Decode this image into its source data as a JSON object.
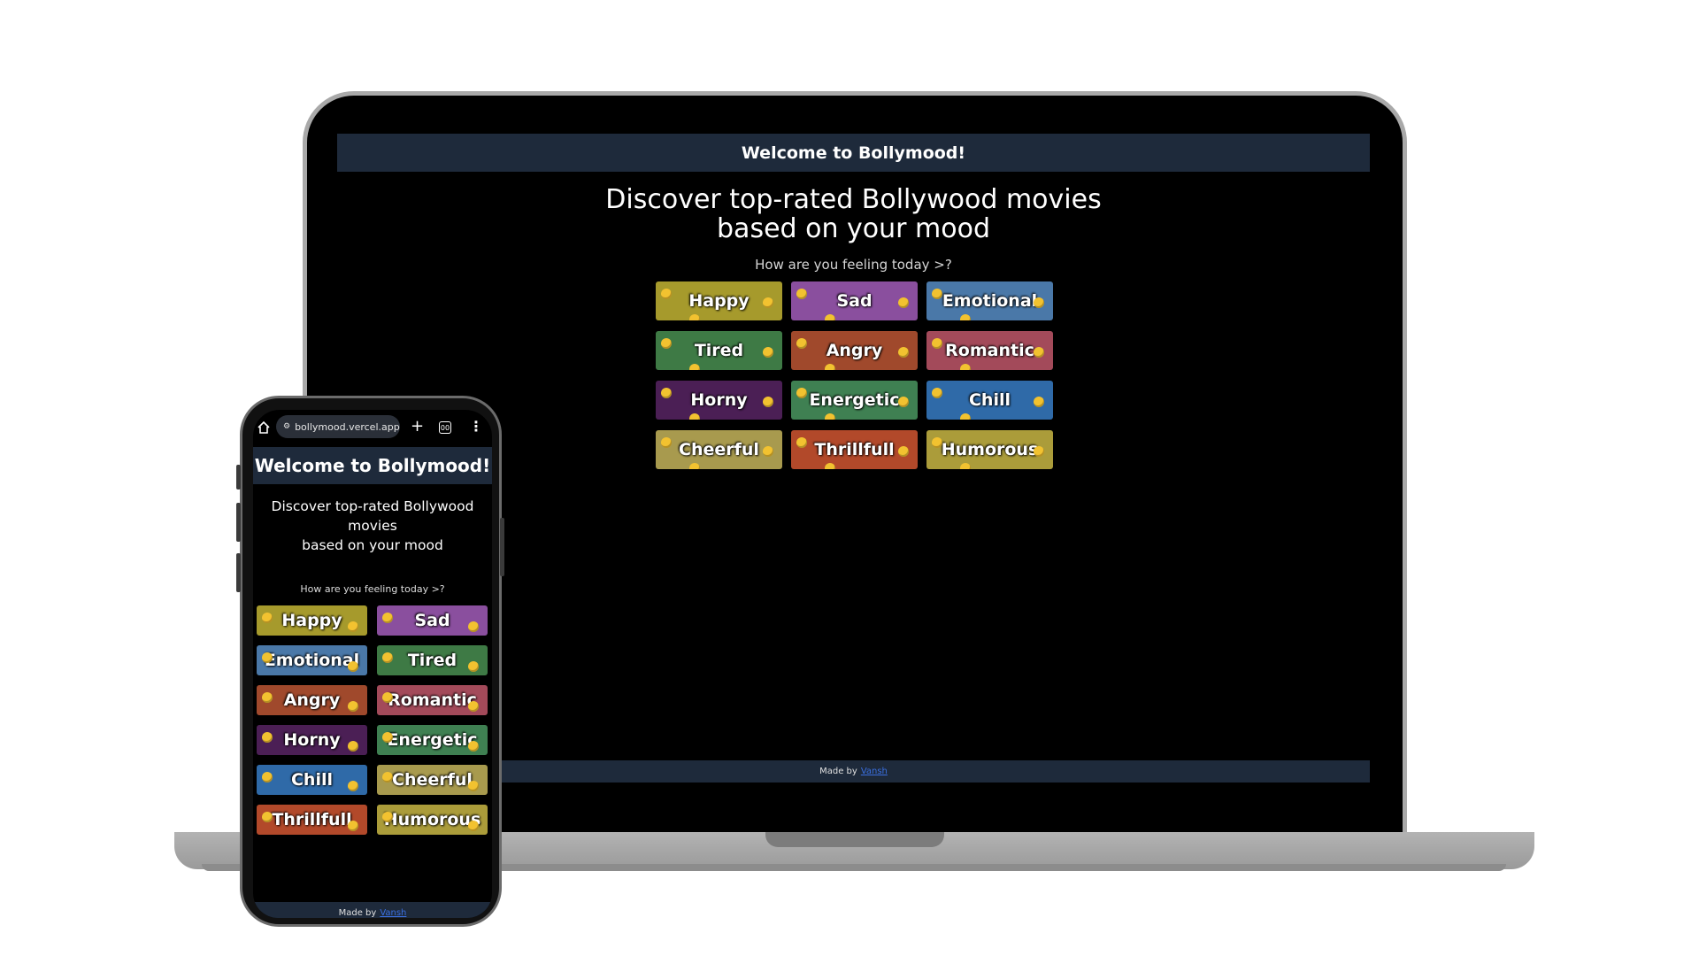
{
  "app": {
    "header_title": "Welcome to Bollymood!",
    "heading_line1": "Discover top-rated Bollywood movies",
    "heading_line2": "based on your mood",
    "mobile_heading_line1": "Discover top-rated Bollywood movies",
    "mobile_heading_line2": "based on your mood",
    "prompt": "How are you feeling today >?",
    "footer_prefix": "Made by",
    "footer_link": "Vansh"
  },
  "browser": {
    "url": "bollymood.vercel.app",
    "tab_count": "00",
    "plus_label": "+",
    "menu_label": "⋮"
  },
  "moods": [
    {
      "label": "Happy",
      "color": "#a69a2c"
    },
    {
      "label": "Sad",
      "color": "#8a4f9e"
    },
    {
      "label": "Emotional",
      "color": "#4a78a8"
    },
    {
      "label": "Tired",
      "color": "#3e7a45"
    },
    {
      "label": "Angry",
      "color": "#a0492c"
    },
    {
      "label": "Romantic",
      "color": "#a34a5a"
    },
    {
      "label": "Horny",
      "color": "#4b1f55"
    },
    {
      "label": "Energetic",
      "color": "#3f8052"
    },
    {
      "label": "Chill",
      "color": "#2f6aa8"
    },
    {
      "label": "Cheerful",
      "color": "#a89a4e"
    },
    {
      "label": "Thrillfull",
      "color": "#b2492a"
    },
    {
      "label": "Humorous",
      "color": "#ab9c3a"
    }
  ],
  "mobile_moods": [
    {
      "label": "Happy",
      "color": "#a69a2c"
    },
    {
      "label": "Sad",
      "color": "#8a4f9e"
    },
    {
      "label": "Emotional",
      "color": "#4a78a8"
    },
    {
      "label": "Tired",
      "color": "#3e7a45"
    },
    {
      "label": "Angry",
      "color": "#a0492c"
    },
    {
      "label": "Romantic",
      "color": "#a34a5a"
    },
    {
      "label": "Horny",
      "color": "#4b1f55"
    },
    {
      "label": "Energetic",
      "color": "#3f8052"
    },
    {
      "label": "Chill",
      "color": "#2f6aa8"
    },
    {
      "label": "Cheerful",
      "color": "#a89a4e"
    },
    {
      "label": "Thrillfull",
      "color": "#b2492a"
    },
    {
      "label": "Humorous",
      "color": "#ab9c3a"
    }
  ]
}
